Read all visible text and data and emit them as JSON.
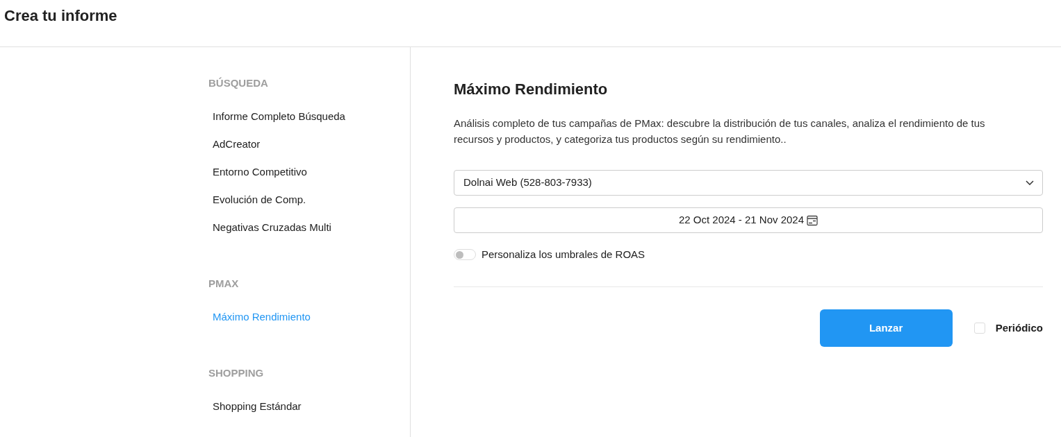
{
  "header": {
    "title": "Crea tu informe"
  },
  "sidebar": {
    "sections": [
      {
        "heading": "BÚSQUEDA",
        "items": [
          {
            "label": "Informe Completo Búsqueda",
            "selected": false
          },
          {
            "label": "AdCreator",
            "selected": false
          },
          {
            "label": "Entorno Competitivo",
            "selected": false
          },
          {
            "label": "Evolución de Comp.",
            "selected": false
          },
          {
            "label": "Negativas Cruzadas Multi",
            "selected": false
          }
        ]
      },
      {
        "heading": "PMAX",
        "items": [
          {
            "label": "Máximo Rendimiento",
            "selected": true
          }
        ]
      },
      {
        "heading": "SHOPPING",
        "items": [
          {
            "label": "Shopping Estándar",
            "selected": false
          }
        ]
      }
    ]
  },
  "main": {
    "title": "Máximo Rendimiento",
    "description": "Análisis completo de tus campañas de PMax: descubre la distribución de tus canales, analiza el rendimiento de tus recursos y productos, y categoriza tus productos según su rendimiento..",
    "account_select": {
      "value": "Dolnai Web (528-803-7933)"
    },
    "date_range": {
      "value": "22 Oct 2024 - 21 Nov 2024"
    },
    "roas_toggle": {
      "label": "Personaliza los umbrales de ROAS",
      "on": false
    },
    "launch_button": {
      "label": "Lanzar"
    },
    "periodic": {
      "label": "Periódico",
      "checked": false
    }
  }
}
